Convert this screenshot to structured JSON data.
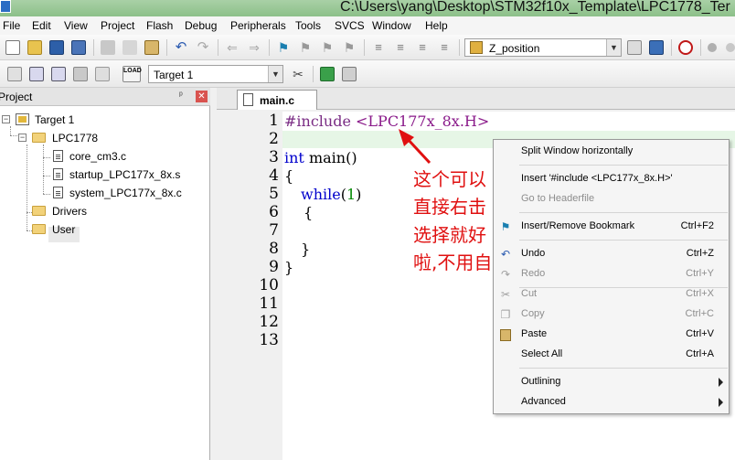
{
  "window": {
    "title": "C:\\Users\\yang\\Desktop\\STM32f10x_Template\\LPC1778_Ter"
  },
  "menu": [
    "File",
    "Edit",
    "View",
    "Project",
    "Flash",
    "Debug",
    "Peripherals",
    "Tools",
    "SVCS",
    "Window",
    "Help"
  ],
  "toolbar": {
    "search_combo_value": "Z_position",
    "target_combo_value": "Target 1",
    "load_button_label": "LOAD"
  },
  "project_panel": {
    "title": "Project",
    "pin_glyph": "ᵖ",
    "close_glyph": "✕",
    "tree": {
      "target": "Target 1",
      "group": "LPC1778",
      "files": [
        "core_cm3.c",
        "startup_LPC177x_8x.s",
        "system_LPC177x_8x.c"
      ],
      "folders": [
        "Drivers",
        "User"
      ]
    }
  },
  "editor": {
    "tab": "main.c",
    "line_numbers": [
      "1",
      "2",
      "3",
      "4",
      "5",
      "6",
      "7",
      "8",
      "9",
      "10",
      "11",
      "12",
      "13"
    ],
    "code": {
      "l1_directive": "#include",
      "l1_header": "<LPC177x_8x.H>",
      "l3_kw": "int",
      "l3_rest": " main()",
      "l4": "{",
      "l5_kw": "while",
      "l5_open": "(",
      "l5_num": "1",
      "l5_close": ")",
      "l6": "{",
      "l8": "}",
      "l9": "}"
    }
  },
  "annotation": {
    "lines": [
      "这个可以",
      "直接右击",
      "选择就好",
      "啦,不用自己敲"
    ],
    "color": "#e01010"
  },
  "context_menu": {
    "items": [
      {
        "label": "Split Window horizontally",
        "shortcut": "",
        "disabled": false
      },
      {
        "label": "Insert '#include <LPC177x_8x.H>'",
        "shortcut": "",
        "disabled": false
      },
      {
        "label": "Go to Headerfile",
        "shortcut": "",
        "disabled": true
      },
      {
        "label": "Insert/Remove Bookmark",
        "shortcut": "Ctrl+F2",
        "disabled": false
      },
      {
        "label": "Undo",
        "shortcut": "Ctrl+Z",
        "disabled": false
      },
      {
        "label": "Redo",
        "shortcut": "Ctrl+Y",
        "disabled": true
      },
      {
        "label": "Cut",
        "shortcut": "Ctrl+X",
        "disabled": true
      },
      {
        "label": "Copy",
        "shortcut": "Ctrl+C",
        "disabled": true
      },
      {
        "label": "Paste",
        "shortcut": "Ctrl+V",
        "disabled": false
      },
      {
        "label": "Select All",
        "shortcut": "Ctrl+A",
        "disabled": false
      },
      {
        "label": "Outlining",
        "shortcut": "",
        "disabled": false,
        "submenu": true
      },
      {
        "label": "Advanced",
        "shortcut": "",
        "disabled": false,
        "submenu": true
      }
    ]
  }
}
